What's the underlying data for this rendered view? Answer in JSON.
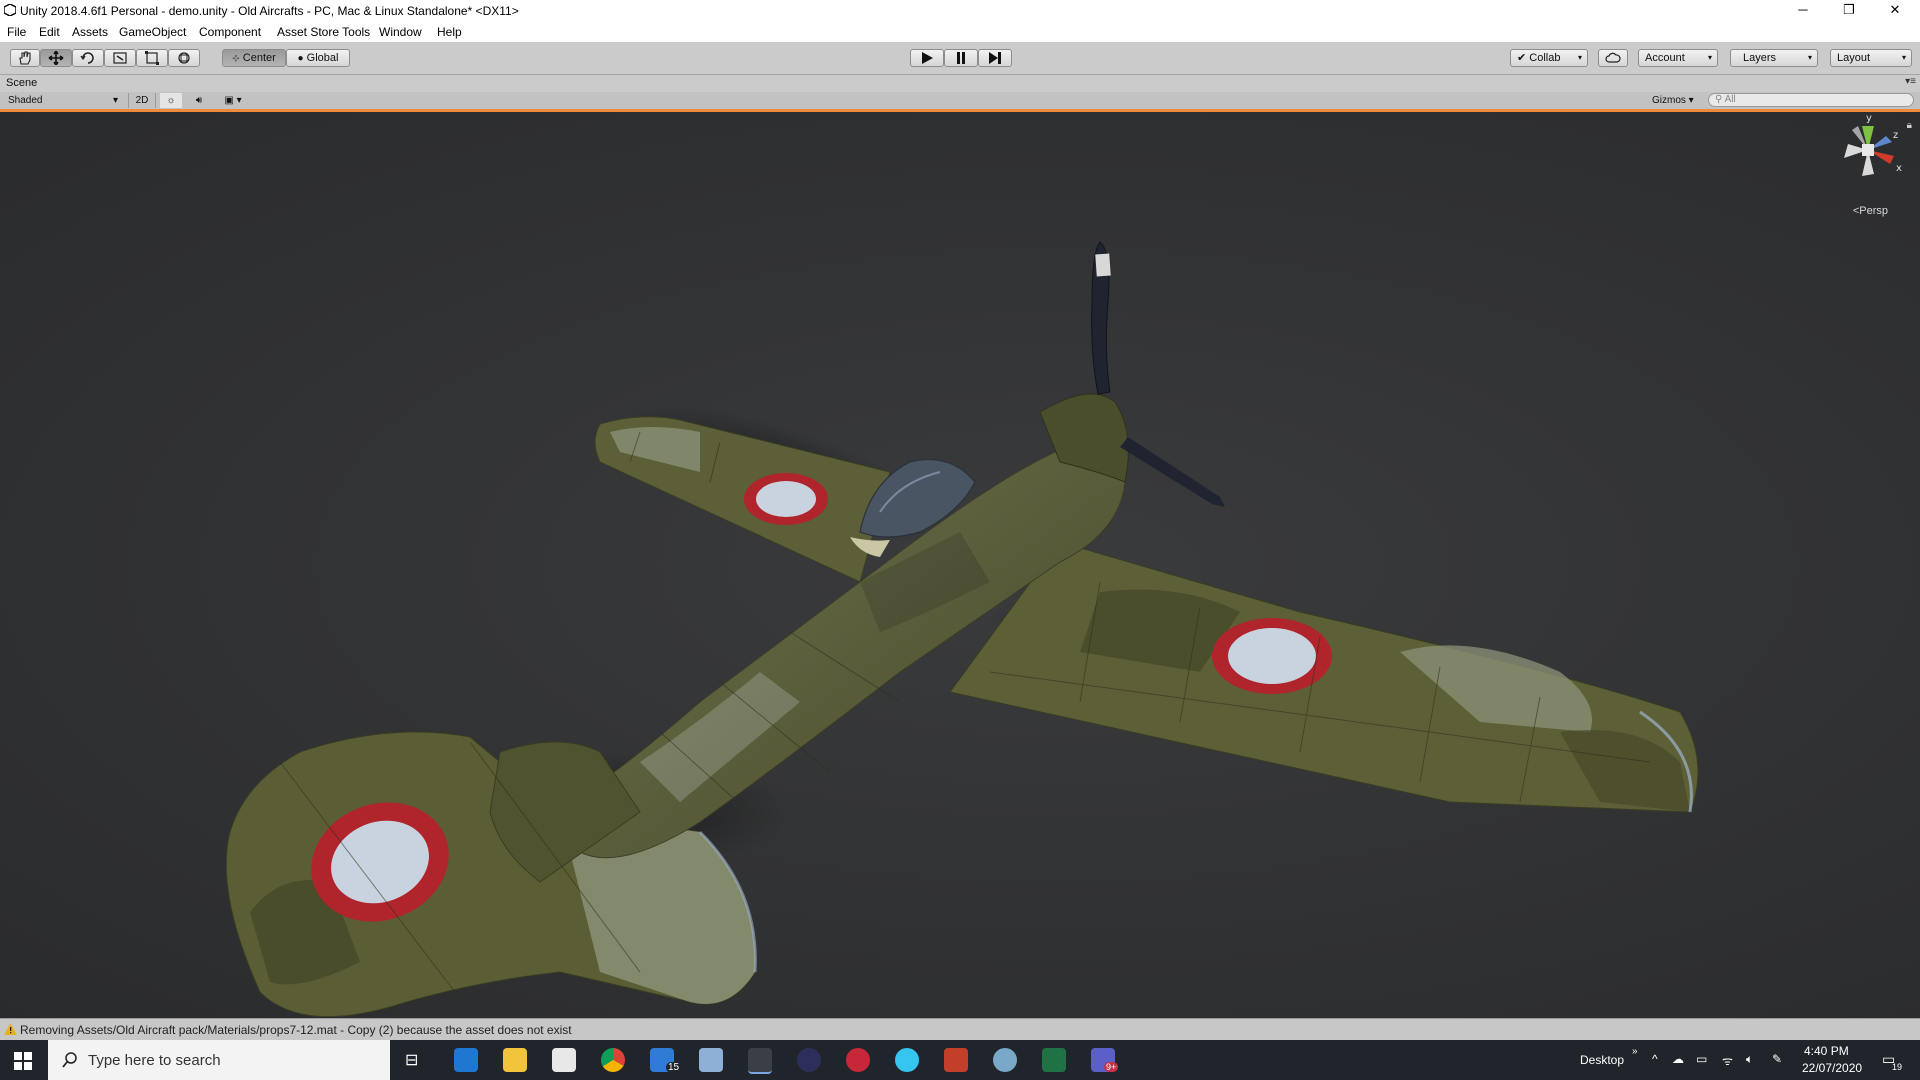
{
  "window": {
    "title": "Unity 2018.4.6f1 Personal - demo.unity - Old Aircrafts - PC, Mac & Linux Standalone* <DX11>",
    "controls": {
      "minimize": "─",
      "restore": "❐",
      "close": "✕"
    }
  },
  "menu": [
    "File",
    "Edit",
    "Assets",
    "GameObject",
    "Component",
    "Asset Store Tools",
    "Window",
    "Help"
  ],
  "toolbar": {
    "pivot_label": "Center",
    "space_label": "Global",
    "collab_label": "Collab",
    "account_label": "Account",
    "layers_label": "Layers",
    "layout_label": "Layout"
  },
  "scene": {
    "tab_label": "Scene",
    "shading_mode": "Shaded",
    "mode_2d": "2D",
    "gizmos_label": "Gizmos",
    "search_placeholder": "All",
    "projection_label": "Persp",
    "gizmo_axes": {
      "y": "y",
      "x": "x",
      "z": "z"
    }
  },
  "aircraft": {
    "camo_base": "#5b5e35",
    "camo_light": "#8c9279",
    "camo_dark": "#3e4026",
    "roundel_outer": "#b0242c",
    "roundel_inner": "#c9d2df"
  },
  "status": {
    "message": "Removing Assets/Old Aircraft pack/Materials/props7-12.mat - Copy (2) because the asset does not exist"
  },
  "taskbar": {
    "search_placeholder": "Type here to search",
    "desktop_label": "Desktop",
    "time": "4:40 PM",
    "date": "22/07/2020",
    "mail_badge": "15",
    "teams_badge": "9+",
    "notification_count": "19"
  }
}
